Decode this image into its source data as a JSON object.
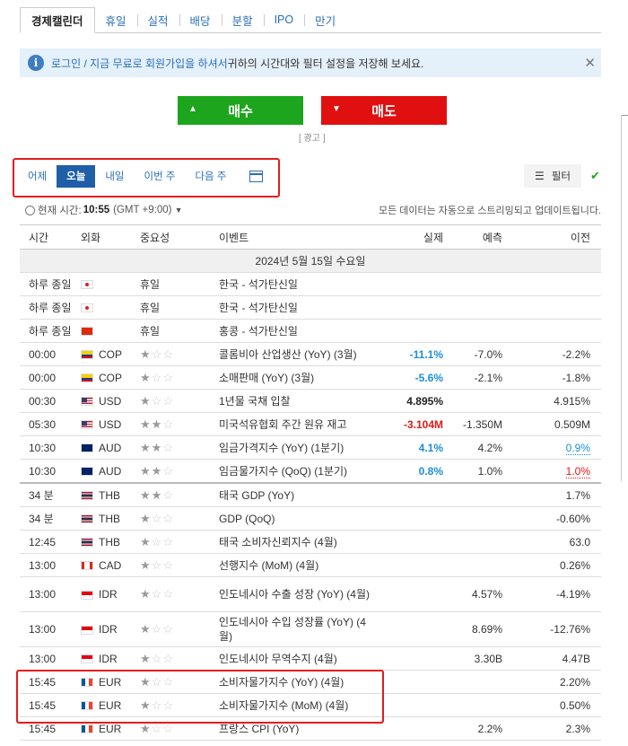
{
  "tabs": [
    "경제캘린더",
    "휴일",
    "실적",
    "배당",
    "분할",
    "IPO",
    "만기"
  ],
  "notice": {
    "link": "로그인 / 지금 무료로 회원가입을 하셔서",
    "text": " 귀하의 시간대와 필터 설정을 저장해 보세요."
  },
  "trade": {
    "buy": "매수",
    "sell": "매도",
    "ad": "[ 광고 ]"
  },
  "days": [
    "어제",
    "오늘",
    "내일",
    "이번 주",
    "다음 주"
  ],
  "filter_label": "필터",
  "time": {
    "label": "현재 시간:",
    "value": "10:55",
    "tz": "(GMT +9:00)"
  },
  "stream_text": "모든 데이터는 자동으로 스트리밍되고 업데이트됩니다.",
  "columns": [
    "시간",
    "외화",
    "중요성",
    "이벤트",
    "실제",
    "예측",
    "이전"
  ],
  "date_row": "2024년 5월 15일 수요일",
  "rows": [
    {
      "time": "하루 종일",
      "flag": "kr",
      "cur": "",
      "imp": "휴일",
      "event": "한국 - 석가탄신일",
      "actual": "",
      "forecast": "",
      "prev": ""
    },
    {
      "time": "하루 종일",
      "flag": "kr",
      "cur": "",
      "imp": "휴일",
      "event": "한국 - 석가탄신일",
      "actual": "",
      "forecast": "",
      "prev": ""
    },
    {
      "time": "하루 종일",
      "flag": "hk",
      "cur": "",
      "imp": "휴일",
      "event": "홍콩 - 석가탄신일",
      "actual": "",
      "forecast": "",
      "prev": ""
    },
    {
      "time": "00:00",
      "flag": "co",
      "cur": "COP",
      "stars": 1,
      "event": "콜롬비아 산업생산 (YoY) (3월)",
      "actual": "-11.1%",
      "astyle": "pos",
      "forecast": "-7.0%",
      "prev": "-2.2%"
    },
    {
      "time": "00:00",
      "flag": "co",
      "cur": "COP",
      "stars": 1,
      "event": "소매판매 (YoY) (3월)",
      "actual": "-5.6%",
      "astyle": "pos",
      "forecast": "-2.1%",
      "prev": "-1.8%"
    },
    {
      "time": "00:30",
      "flag": "us",
      "cur": "USD",
      "stars": 1,
      "event": "1년물 국채 입찰",
      "actual": "4.895%",
      "astyle": "bold",
      "forecast": "",
      "prev": "4.915%"
    },
    {
      "time": "05:30",
      "flag": "us",
      "cur": "USD",
      "stars": 2,
      "event": "미국석유협회 주간 원유 재고",
      "actual": "-3.104M",
      "astyle": "neg",
      "forecast": "-1.350M",
      "prev": "0.509M"
    },
    {
      "time": "10:30",
      "flag": "au",
      "cur": "AUD",
      "stars": 2,
      "event": "임금가격지수 (YoY) (1분기)",
      "actual": "4.1%",
      "astyle": "pos",
      "forecast": "4.2%",
      "prev": "0.9%",
      "pstyle": "ul-blue"
    },
    {
      "time": "10:30",
      "flag": "au",
      "cur": "AUD",
      "stars": 2,
      "event": "임금물가지수 (QoQ) (1분기)",
      "actual": "0.8%",
      "astyle": "pos",
      "forecast": "1.0%",
      "prev": "1.0%",
      "pstyle": "ul-red"
    },
    {
      "time": "34 분",
      "flag": "th",
      "cur": "THB",
      "stars": 2,
      "event": "태국 GDP (YoY)",
      "actual": "",
      "forecast": "",
      "prev": "1.7%",
      "sep": true
    },
    {
      "time": "34 분",
      "flag": "th",
      "cur": "THB",
      "stars": 1,
      "event": "GDP (QoQ)",
      "actual": "",
      "forecast": "",
      "prev": "-0.60%"
    },
    {
      "time": "12:45",
      "flag": "th",
      "cur": "THB",
      "stars": 1,
      "event": "태국 소비자신뢰지수 (4월)",
      "actual": "",
      "forecast": "",
      "prev": "63.0"
    },
    {
      "time": "13:00",
      "flag": "ca",
      "cur": "CAD",
      "stars": 1,
      "event": "선행지수 (MoM) (4월)",
      "actual": "",
      "forecast": "",
      "prev": "0.26%"
    },
    {
      "time": "13:00",
      "flag": "id",
      "cur": "IDR",
      "stars": 1,
      "event": "인도네시아 수출 성장 (YoY) (4월)",
      "actual": "",
      "forecast": "4.57%",
      "prev": "-4.19%",
      "tall": true
    },
    {
      "time": "13:00",
      "flag": "id",
      "cur": "IDR",
      "stars": 1,
      "event": "인도네시아 수입 성장률 (YoY) (4월)",
      "actual": "",
      "forecast": "8.69%",
      "prev": "-12.76%",
      "tall": true
    },
    {
      "time": "13:00",
      "flag": "id",
      "cur": "IDR",
      "stars": 1,
      "event": "인도네시아 무역수지 (4월)",
      "actual": "",
      "forecast": "3.30B",
      "prev": "4.47B"
    },
    {
      "time": "15:45",
      "flag": "eu",
      "cur": "EUR",
      "stars": 1,
      "event": "소비자물가지수 (YoY) (4월)",
      "actual": "",
      "forecast": "",
      "prev": "2.20%"
    },
    {
      "time": "15:45",
      "flag": "eu",
      "cur": "EUR",
      "stars": 1,
      "event": "소비자물가지수 (MoM) (4월)",
      "actual": "",
      "forecast": "",
      "prev": "0.50%"
    },
    {
      "time": "15:45",
      "flag": "eu",
      "cur": "EUR",
      "stars": 1,
      "event": "프랑스 CPI (YoY)",
      "actual": "",
      "forecast": "2.2%",
      "prev": "2.3%"
    }
  ]
}
